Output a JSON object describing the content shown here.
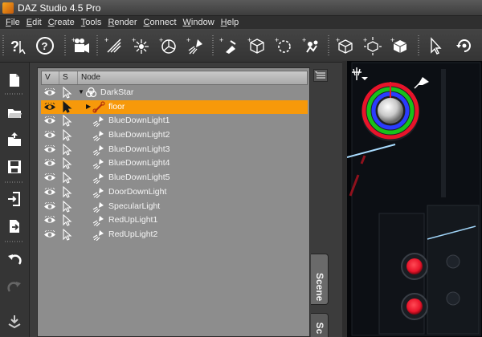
{
  "window": {
    "title": "DAZ Studio 4.5 Pro"
  },
  "menubar": [
    {
      "key": "F",
      "rest": "ile"
    },
    {
      "key": "E",
      "rest": "dit"
    },
    {
      "key": "C",
      "rest": "reate"
    },
    {
      "key": "T",
      "rest": "ools"
    },
    {
      "key": "R",
      "rest": "ender"
    },
    {
      "key": "C",
      "rest": "onnect"
    },
    {
      "key": "W",
      "rest": "indow"
    },
    {
      "key": "H",
      "rest": "elp"
    }
  ],
  "toolbar": {
    "icons": [
      "whats-this-icon",
      "help-icon",
      "create-camera-icon",
      "create-distant-light-icon",
      "create-point-light-icon",
      "create-spot-light-icon",
      "create-light-icon",
      "create-primitive-icon",
      "create-null-icon",
      "create-group-icon",
      "create-figure-icon",
      "create-cube-icon",
      "create-cube-group-icon",
      "create-cube-selected-icon",
      "select-tool-icon",
      "rotate-tool-icon"
    ]
  },
  "leftbar": {
    "icons": [
      "new-scene-icon",
      "open-file-icon",
      "merge-file-icon",
      "save-icon",
      "import-icon",
      "export-icon",
      "undo-icon",
      "redo-icon",
      "download-icon"
    ]
  },
  "scene": {
    "headers": {
      "v": "V",
      "s": "S",
      "node": "Node"
    },
    "rows": [
      {
        "label": "DarkStar",
        "icon": "group-icon",
        "expander": "▼",
        "selected": false,
        "level": 0
      },
      {
        "label": "floor",
        "icon": "bone-icon",
        "expander": "▶",
        "selected": true,
        "level": 1
      },
      {
        "label": "BlueDownLight1",
        "icon": "spotlight-icon",
        "selected": false,
        "level": 1
      },
      {
        "label": "BlueDownLight2",
        "icon": "spotlight-icon",
        "selected": false,
        "level": 1
      },
      {
        "label": "BlueDownLight3",
        "icon": "spotlight-icon",
        "selected": false,
        "level": 1
      },
      {
        "label": "BlueDownLight4",
        "icon": "spotlight-icon",
        "selected": false,
        "level": 1
      },
      {
        "label": "BlueDownLight5",
        "icon": "spotlight-icon",
        "selected": false,
        "level": 1
      },
      {
        "label": "DoorDownLight",
        "icon": "spotlight-icon",
        "selected": false,
        "level": 1
      },
      {
        "label": "SpecularLight",
        "icon": "spotlight-icon",
        "selected": false,
        "level": 1
      },
      {
        "label": "RedUpLight1",
        "icon": "spotlight-icon",
        "selected": false,
        "level": 1
      },
      {
        "label": "RedUpLight2",
        "icon": "spotlight-icon",
        "selected": false,
        "level": 1
      }
    ]
  },
  "tabs": {
    "scene": "Scene",
    "second": "Sc"
  },
  "colors": {
    "selection": "#f7990a",
    "accent_red": "#e8142a",
    "accent_green": "#18c21a",
    "accent_blue": "#2a3cff"
  }
}
